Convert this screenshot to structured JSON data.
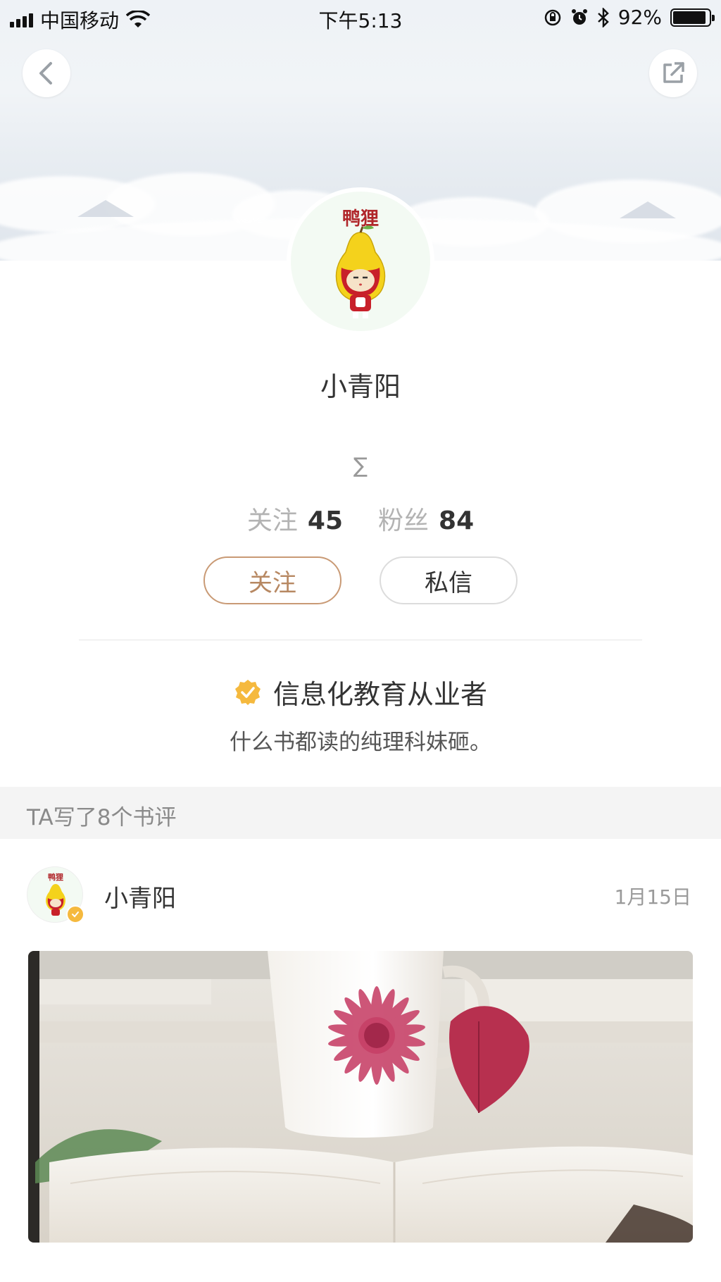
{
  "status_bar": {
    "carrier": "中国移动",
    "time": "下午5:13",
    "battery": "92%",
    "battery_level": 0.92,
    "icons": [
      "signal-icon",
      "wifi-icon",
      "rotation-lock-icon",
      "alarm-icon",
      "bluetooth-icon",
      "battery-icon"
    ]
  },
  "header": {
    "back_icon": "chevron-left-icon",
    "share_icon": "share-external-icon"
  },
  "profile": {
    "avatar_caption": "鸭狸",
    "name": "小青阳",
    "gender_symbol": "∑",
    "following_label": "关注",
    "following_count": "45",
    "followers_label": "粉丝",
    "followers_count": "84",
    "follow_button": "关注",
    "message_button": "私信",
    "verified_title": "信息化教育从业者",
    "bio": "什么书都读的纯理科妹砸。"
  },
  "reviews": {
    "section_title": "TA写了8个书评",
    "items": [
      {
        "author": "小青阳",
        "date": "1月15日",
        "image": "cup-flower-book-photo"
      }
    ]
  },
  "colors": {
    "accent": "#c99a75",
    "verified": "#f5b93e",
    "section_bg": "#f4f4f4"
  }
}
